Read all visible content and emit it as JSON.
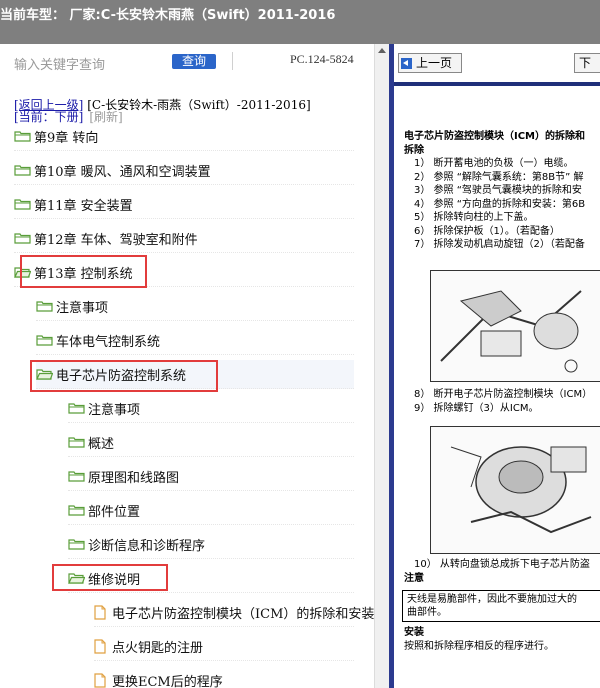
{
  "title_bar": {
    "text": "当前车型： 厂家:C-长安铃木雨燕（Swift）2011-2016"
  },
  "search": {
    "placeholder": "输入关键字查询",
    "button_label": "查询",
    "doc_code": "PC.124-5824"
  },
  "nav": {
    "back_label": "[返回上一级]",
    "breadcrumb": "[C-长安铃木-雨燕（Swift）-2011-2016]",
    "current_label": "[当前：下册]",
    "refresh_label": "[刷新]"
  },
  "tree": [
    {
      "label": "第9章 转向",
      "kind": "folder"
    },
    {
      "label": "第10章 暖风、通风和空调装置",
      "kind": "folder"
    },
    {
      "label": "第11章 安全装置",
      "kind": "folder"
    },
    {
      "label": "第12章 车体、驾驶室和附件",
      "kind": "folder"
    },
    {
      "label": "第13章 控制系统",
      "kind": "folder-open"
    },
    {
      "label": "注意事项",
      "kind": "folder"
    },
    {
      "label": "车体电气控制系统",
      "kind": "folder"
    },
    {
      "label": "电子芯片防盗控制系统",
      "kind": "folder-open"
    },
    {
      "label": "注意事项",
      "kind": "folder"
    },
    {
      "label": "概述",
      "kind": "folder"
    },
    {
      "label": "原理图和线路图",
      "kind": "folder"
    },
    {
      "label": "部件位置",
      "kind": "folder"
    },
    {
      "label": "诊断信息和诊断程序",
      "kind": "folder"
    },
    {
      "label": "维修说明",
      "kind": "folder-open"
    },
    {
      "label": "电子芯片防盗控制模块（ICM）的拆除和安装",
      "kind": "file"
    },
    {
      "label": "点火钥匙的注册",
      "kind": "file"
    },
    {
      "label": "更换ECM后的程序",
      "kind": "file"
    }
  ],
  "doc_nav": {
    "prev_label": "上一页",
    "next_label": "下"
  },
  "document": {
    "heading": "电子芯片防盗控制模块（ICM）的拆除和",
    "removal_title": "拆除",
    "steps": [
      "1） 断开蓄电池的负极（一）电缆。",
      "2） 参照 “解除气囊系统：第8B节” 解",
      "3） 参照 “驾驶员气囊模块的拆除和安",
      "4） 参照 “方向盘的拆除和安装：第6B",
      "5） 拆除转向柱的上下盖。",
      "6） 拆除保护板（1）。（若配备）",
      "7） 拆除发动机启动旋钮（2）（若配备"
    ],
    "steps_2": [
      "8） 断开电子芯片防盗控制模块（ICM）",
      "9） 拆除螺钉（3）从ICM。"
    ],
    "step_10": "10） 从转向盘锁总成拆下电子芯片防盗",
    "note_title": "注意",
    "warning_lines": [
      "天线是易脆部件，因此不要施加过大的",
      "曲部件。"
    ],
    "install_title": "安装",
    "install_text": "按照和拆除程序相反的程序进行。"
  },
  "colors": {
    "title_bar_bg": "#7f7f7f",
    "accent": "#2b65c9",
    "divider": "#2b3a8f",
    "highlight": "#e23c3c",
    "folder": "#5a9e3a"
  }
}
